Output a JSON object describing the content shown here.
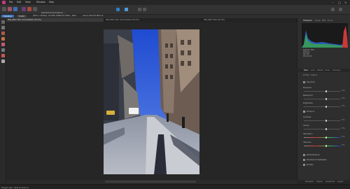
{
  "menu": {
    "items": [
      "File",
      "Edit",
      "View",
      "Window",
      "Help"
    ]
  },
  "toolbar": {
    "context_text": "Add text and formats & tables"
  },
  "context_bar": {
    "persona_label": "Develop",
    "left_label": "Detail",
    "info_text": "4032 × 3024px, 16.2MP, RGBA/32 (HDR) - RAW",
    "camera_text": "Canon EOS 5D Mark III"
  },
  "document_tabs": [
    {
      "label": "IMG_8847 CR2 (Unmodified) (75.4%)"
    },
    {
      "label": "IMG_8847 CR2 (Unmodified) (76.4%)"
    },
    {
      "label": "IMG_8847 CR2 (25.0%)"
    }
  ],
  "right_panel": {
    "top_tabs": [
      "Histogram",
      "Scope",
      "EXIF",
      "Focus"
    ],
    "exif_lines": [
      "Aperture: f/8.0",
      "1/60 Sec",
      "ISO 320",
      "f/3.5 17mm"
    ],
    "mid_tabs": [
      "Basic",
      "Lens",
      "Details",
      "Tones",
      "Overlays"
    ],
    "section_tabs": [
      "Profiles",
      "Output"
    ],
    "groups": [
      {
        "label": "White Balance"
      },
      {
        "label": "Shadows & Highlights"
      },
      {
        "label": "Profiles"
      }
    ],
    "checkbox_labels": [
      "Exposure",
      "Enhance"
    ],
    "sliders": [
      {
        "label": "Exposure",
        "value": "0 %",
        "pos": 0.62
      },
      {
        "label": "Blackpoint",
        "value": "0 %",
        "pos": 0.62
      },
      {
        "label": "Brightness",
        "value": "0 %",
        "pos": 0.62
      },
      {
        "label": "Contrast",
        "value": "0 %",
        "pos": 0.62
      },
      {
        "label": "Clarity",
        "value": "0 %",
        "pos": 0.62
      },
      {
        "label": "Saturation",
        "value": "0 %",
        "pos": 0.62
      },
      {
        "label": "Vibrance",
        "value": "0 %",
        "pos": 0.62
      }
    ],
    "bottom_tabs": [
      "Navigator",
      "History",
      "Snapshots",
      "Layers"
    ]
  },
  "status": {
    "text": "Drag to pan. Click to zoom in."
  },
  "colors": {
    "accent": "#3d6fb6",
    "app_logo": "#c23a7a"
  }
}
